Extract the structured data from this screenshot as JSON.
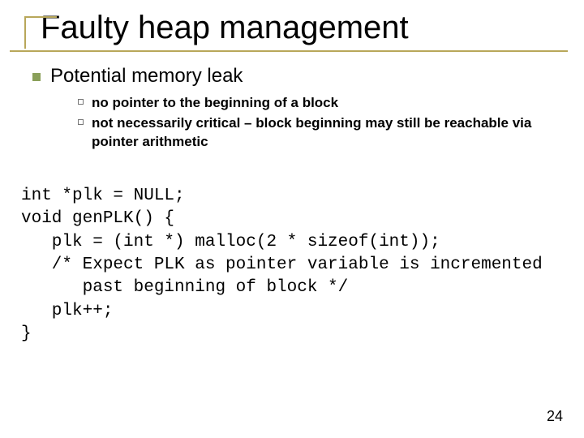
{
  "title": "Faulty heap management",
  "bullet1": "Potential memory leak",
  "sub1": "no pointer to the beginning of a block",
  "sub2": "not necessarily critical – block beginning may still be reachable via pointer arithmetic",
  "code": "int *plk = NULL;\nvoid genPLK() {\n   plk = (int *) malloc(2 * sizeof(int));\n   /* Expect PLK as pointer variable is incremented\n      past beginning of block */\n   plk++;\n}",
  "page": "24"
}
